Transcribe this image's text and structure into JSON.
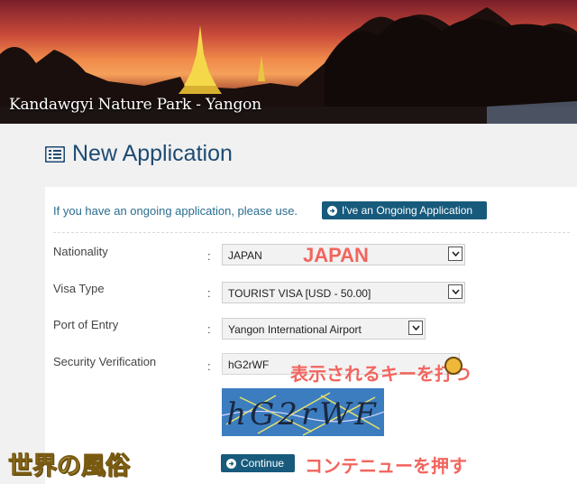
{
  "banner": {
    "caption": "Kandawgyi Nature Park - Yangon"
  },
  "page": {
    "title": "New Application"
  },
  "ongoing": {
    "text": "If you have an ongoing application, please use.",
    "button_label": "I've an Ongoing Application"
  },
  "form": {
    "nationality": {
      "label": "Nationality",
      "value": "JAPAN"
    },
    "visa_type": {
      "label": "Visa Type",
      "value": "TOURIST VISA [USD - 50.00]"
    },
    "port_of_entry": {
      "label": "Port of Entry",
      "value": "Yangon International Airport"
    },
    "security": {
      "label": "Security Verification",
      "value": "hG2rWF",
      "captcha_text": "hG2rWF"
    },
    "colon": ":",
    "continue_label": "Continue"
  },
  "annotations": {
    "nationality_note": "JAPAN",
    "captcha_note": "表示されるキーを打つ",
    "continue_note": "コンテニューを押す",
    "watermark": "世界の風俗"
  },
  "colors": {
    "navy": "#1e4b73",
    "button": "#175a7c",
    "annotation": "#f2655e"
  }
}
